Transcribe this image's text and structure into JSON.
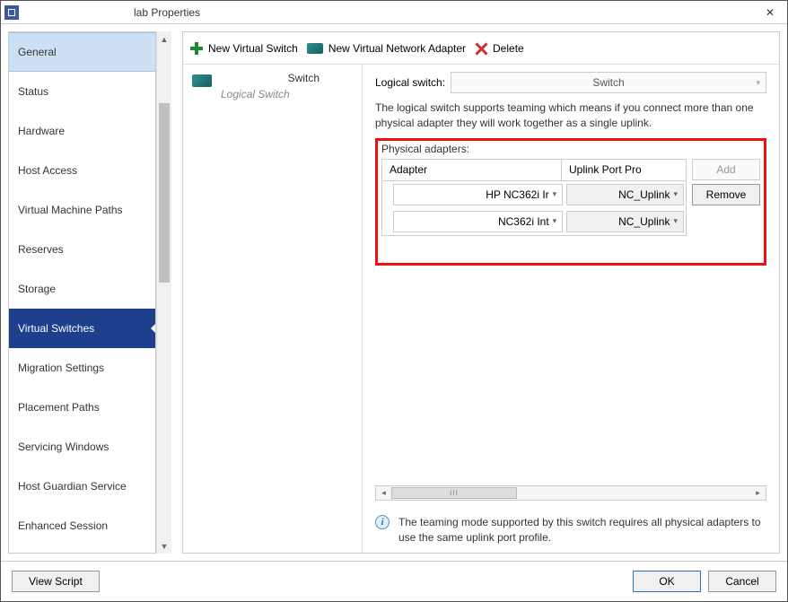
{
  "window": {
    "title": "lab Properties"
  },
  "sidebar": {
    "items": [
      {
        "label": "General"
      },
      {
        "label": "Status"
      },
      {
        "label": "Hardware"
      },
      {
        "label": "Host Access"
      },
      {
        "label": "Virtual Machine Paths"
      },
      {
        "label": "Reserves"
      },
      {
        "label": "Storage"
      },
      {
        "label": "Virtual Switches"
      },
      {
        "label": "Migration Settings"
      },
      {
        "label": "Placement Paths"
      },
      {
        "label": "Servicing Windows"
      },
      {
        "label": "Host Guardian Service"
      },
      {
        "label": "Enhanced Session"
      }
    ],
    "selected_index": 7
  },
  "toolbar": {
    "new_switch": "New Virtual Switch",
    "new_adapter": "New Virtual Network Adapter",
    "delete": "Delete"
  },
  "switch_list": {
    "items": [
      {
        "name": "Switch",
        "subtitle": "Logical Switch"
      }
    ]
  },
  "detail": {
    "logical_switch_label": "Logical switch:",
    "logical_switch_value": "Switch",
    "description": "The logical switch supports teaming which means if you connect more than one physical adapter they will work together as a single uplink.",
    "physical_adapters_label": "Physical adapters:",
    "table_headers": {
      "adapter": "Adapter",
      "uplink": "Uplink Port Pro"
    },
    "rows": [
      {
        "adapter": "HP NC362i Ir",
        "uplink": "NC_Uplink"
      },
      {
        "adapter": "NC362i Int",
        "uplink": "NC_Uplink"
      }
    ],
    "add_btn": "Add",
    "remove_btn": "Remove",
    "info": "The teaming mode supported by this switch requires all physical adapters to use the same uplink port profile."
  },
  "footer": {
    "view_script": "View Script",
    "ok": "OK",
    "cancel": "Cancel"
  }
}
